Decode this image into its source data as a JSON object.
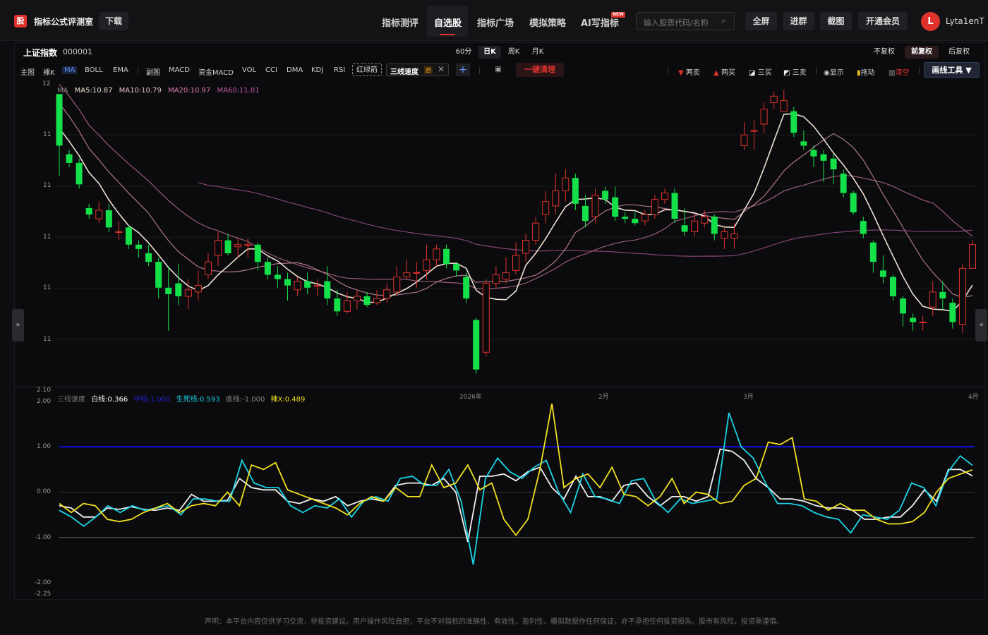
{
  "app": {
    "logo_char": "股",
    "brand": "指标公式评测室",
    "download": "下载"
  },
  "nav": [
    {
      "label": "指标测评"
    },
    {
      "label": "自选股"
    },
    {
      "label": "指标广场"
    },
    {
      "label": "模拟策略"
    },
    {
      "label": "AI写指标"
    }
  ],
  "nav_badge": "NEW",
  "search": {
    "placeholder": "输入股票代码/名称"
  },
  "actions": {
    "fullscreen": "全屏",
    "join_group": "进群",
    "screenshot": "截图",
    "membership": "开通会员"
  },
  "user": {
    "initial": "L",
    "name": "Lyta1enT"
  },
  "stock": {
    "name": "上证指数",
    "code": "000001"
  },
  "periods": [
    {
      "label": "60分"
    },
    {
      "label": "日K"
    },
    {
      "label": "周K"
    },
    {
      "label": "月K"
    }
  ],
  "adjust": [
    {
      "label": "不复权"
    },
    {
      "label": "前复权"
    },
    {
      "label": "后复权"
    }
  ],
  "indicators": [
    "主图",
    "裸K",
    "MA",
    "BOLL",
    "EMA",
    "副图",
    "MACD",
    "资金MACD",
    "VOL",
    "CCI",
    "DMA",
    "KDJ",
    "RSI"
  ],
  "custom_ind": {
    "dashed": "红绿箭",
    "active": "三线速度",
    "tag": "自"
  },
  "toolbar": {
    "add": "+",
    "clear": "一键清理",
    "two_sell": "两卖",
    "two_buy": "两买",
    "three_buy": "三买",
    "three_sell": "三卖",
    "show": "显示",
    "drag": "拖动",
    "clear_all": "清空",
    "draw_tools": "画线工具"
  },
  "ma_legend": {
    "title": "MA",
    "ma5": "MA5:10.87",
    "ma10": "MA10:10.79",
    "ma20": "MA20:10.97",
    "ma60": "MA60:11.01"
  },
  "price_axis": [
    "12",
    "11",
    "11",
    "11",
    "11",
    "11"
  ],
  "sub_legend": {
    "title": "三线速度",
    "white": "白线:0.366",
    "blue": "中线:1.000",
    "cyan": "生死线:0.593",
    "bottom": "底线:-1.000",
    "yellow": "辣X:0.489"
  },
  "sub_axis_top": "2.10",
  "sub_axis": [
    "2.00",
    "1.00",
    "0.00",
    "-1.00",
    "-2.00",
    "-2.25"
  ],
  "date_labels": [
    "2026年",
    "2月",
    "3月",
    "4月"
  ],
  "sidebtn": {
    "left": "»",
    "right": "«"
  },
  "disclaimer": "声明：本平台内容仅供学习交流，非投资建议。用户操作风险自担；平台不对指标的准确性、有效性、盈利性、模拟数据作任何保证，亦不承担任何投资损失。股市有风险，投资需谨慎。",
  "colors": {
    "up": "#e0322d",
    "down": "#14e04a",
    "ma5": "#ede0d0",
    "ma10": "#c98aa0",
    "ma20": "#b06a88",
    "ma60": "#9a4e86",
    "white": "#f0f0f0",
    "cyan": "#19d4e6",
    "yellow": "#f0e020",
    "blue": "#1010e0",
    "accent": "#e0322d"
  },
  "chart_data": [
    {
      "type": "candlestick",
      "title": "上证指数 000001 日K",
      "y_ticks": [
        "12",
        "11",
        "11",
        "11",
        "11",
        "11"
      ],
      "x_labels": [
        "2026年",
        "2月",
        "3月",
        "4月"
      ],
      "candles": [
        [
          11.3,
          11.06,
          10.92,
          11.07
        ],
        [
          11.02,
          10.98,
          10.96,
          11.04
        ],
        [
          10.98,
          10.88,
          10.86,
          11.0
        ],
        [
          10.77,
          10.74,
          10.72,
          10.79
        ],
        [
          10.72,
          10.76,
          10.7,
          10.8
        ],
        [
          10.76,
          10.68,
          10.66,
          10.79
        ],
        [
          10.66,
          10.66,
          10.62,
          10.71
        ],
        [
          10.68,
          10.6,
          10.58,
          10.69
        ],
        [
          10.6,
          10.58,
          10.54,
          10.62
        ],
        [
          10.56,
          10.52,
          10.5,
          10.6
        ],
        [
          10.52,
          10.4,
          10.35,
          10.54
        ],
        [
          10.4,
          10.37,
          10.2,
          10.5
        ],
        [
          10.42,
          10.36,
          10.32,
          10.51
        ],
        [
          10.36,
          10.39,
          10.3,
          10.44
        ],
        [
          10.38,
          10.41,
          10.34,
          10.48
        ],
        [
          10.46,
          10.52,
          10.44,
          10.56
        ],
        [
          10.55,
          10.62,
          10.5,
          10.66
        ],
        [
          10.62,
          10.56,
          10.55,
          10.65
        ],
        [
          10.59,
          10.6,
          10.54,
          10.63
        ],
        [
          10.6,
          10.6,
          10.54,
          10.63
        ],
        [
          10.6,
          10.52,
          10.48,
          10.61
        ],
        [
          10.52,
          10.46,
          10.44,
          10.54
        ],
        [
          10.46,
          10.44,
          10.4,
          10.5
        ],
        [
          10.44,
          10.41,
          10.34,
          10.47
        ],
        [
          10.39,
          10.43,
          10.36,
          10.45
        ],
        [
          10.43,
          10.4,
          10.37,
          10.47
        ],
        [
          10.41,
          10.41,
          10.36,
          10.44
        ],
        [
          10.43,
          10.35,
          10.32,
          10.5
        ],
        [
          10.35,
          10.29,
          10.27,
          10.39
        ],
        [
          10.29,
          10.34,
          10.28,
          10.38
        ],
        [
          10.34,
          10.36,
          10.3,
          10.39
        ],
        [
          10.36,
          10.32,
          10.31,
          10.38
        ],
        [
          10.33,
          10.35,
          10.32,
          10.39
        ],
        [
          10.35,
          10.39,
          10.33,
          10.42
        ],
        [
          10.38,
          10.45,
          10.37,
          10.5
        ],
        [
          10.45,
          10.47,
          10.44,
          10.53
        ],
        [
          10.47,
          10.47,
          10.4,
          10.52
        ],
        [
          10.48,
          10.53,
          10.44,
          10.6
        ],
        [
          10.53,
          10.58,
          10.5,
          10.6
        ],
        [
          10.58,
          10.51,
          10.49,
          10.6
        ],
        [
          10.51,
          10.48,
          10.45,
          10.52
        ],
        [
          10.45,
          10.35,
          10.33,
          10.47
        ],
        [
          10.25,
          10.02,
          10.0,
          10.26
        ],
        [
          10.1,
          10.42,
          10.08,
          10.44
        ],
        [
          10.42,
          10.46,
          10.4,
          10.5
        ],
        [
          10.44,
          10.47,
          10.42,
          10.54
        ],
        [
          10.48,
          10.55,
          10.46,
          10.61
        ],
        [
          10.56,
          10.62,
          10.52,
          10.65
        ],
        [
          10.62,
          10.7,
          10.6,
          10.73
        ],
        [
          10.74,
          10.8,
          10.7,
          10.85
        ],
        [
          10.78,
          10.85,
          10.74,
          10.93
        ],
        [
          10.85,
          10.91,
          10.8,
          10.95
        ],
        [
          10.91,
          10.79,
          10.76,
          10.93
        ],
        [
          10.78,
          10.71,
          10.68,
          10.83
        ],
        [
          10.73,
          10.83,
          10.7,
          10.86
        ],
        [
          10.85,
          10.81,
          10.79,
          10.87
        ],
        [
          10.82,
          10.73,
          10.71,
          10.87
        ],
        [
          10.73,
          10.72,
          10.7,
          10.75
        ],
        [
          10.72,
          10.7,
          10.69,
          10.75
        ],
        [
          10.71,
          10.74,
          10.69,
          10.76
        ],
        [
          10.74,
          10.81,
          10.72,
          10.83
        ],
        [
          10.81,
          10.84,
          10.79,
          10.86
        ],
        [
          10.84,
          10.72,
          10.7,
          10.86
        ],
        [
          10.69,
          10.66,
          10.64,
          10.77
        ],
        [
          10.66,
          10.71,
          10.64,
          10.74
        ],
        [
          10.7,
          10.73,
          10.68,
          10.76
        ],
        [
          10.73,
          10.65,
          10.62,
          10.74
        ],
        [
          10.63,
          10.66,
          10.58,
          10.68
        ],
        [
          10.63,
          10.65,
          10.58,
          10.7
        ],
        [
          11.06,
          11.11,
          11.04,
          11.17
        ],
        [
          11.13,
          11.13,
          11.04,
          11.18
        ],
        [
          11.16,
          11.23,
          11.12,
          11.26
        ],
        [
          11.26,
          11.29,
          11.23,
          11.31
        ],
        [
          11.22,
          11.27,
          11.23,
          11.32
        ],
        [
          11.22,
          11.12,
          11.1,
          11.24
        ],
        [
          11.08,
          11.06,
          11.04,
          11.13
        ],
        [
          11.04,
          11.01,
          10.96,
          11.06
        ],
        [
          11.02,
          10.99,
          10.89,
          11.04
        ],
        [
          11.0,
          10.95,
          10.88,
          11.02
        ],
        [
          10.93,
          10.84,
          10.82,
          10.95
        ],
        [
          10.84,
          10.75,
          10.74,
          10.85
        ],
        [
          10.71,
          10.65,
          10.63,
          10.73
        ],
        [
          10.61,
          10.52,
          10.47,
          10.62
        ],
        [
          10.48,
          10.45,
          10.42,
          10.55
        ],
        [
          10.45,
          10.36,
          10.34,
          10.46
        ],
        [
          10.35,
          10.28,
          10.22,
          10.36
        ],
        [
          10.26,
          10.24,
          10.2,
          10.28
        ],
        [
          10.24,
          10.24,
          10.2,
          10.27
        ],
        [
          10.31,
          10.38,
          10.27,
          10.43
        ],
        [
          10.38,
          10.35,
          10.3,
          10.43
        ],
        [
          10.33,
          10.24,
          10.21,
          10.35
        ],
        [
          10.23,
          10.49,
          10.19,
          10.51
        ],
        [
          10.49,
          10.6,
          10.5,
          10.62
        ]
      ],
      "series": [
        {
          "name": "MA5",
          "latest": 10.87
        },
        {
          "name": "MA10",
          "latest": 10.79
        },
        {
          "name": "MA20",
          "latest": 10.97
        },
        {
          "name": "MA60",
          "latest": 11.01
        }
      ]
    },
    {
      "type": "line",
      "title": "三线速度",
      "ylim": [
        -2.25,
        2.1
      ],
      "y_ticks": [
        2.0,
        1.0,
        0.0,
        -1.0,
        -2.0
      ],
      "series": [
        {
          "name": "白线",
          "latest": 0.366,
          "values": [
            -0.3,
            -0.35,
            -0.55,
            -0.55,
            -0.35,
            -0.38,
            -0.32,
            -0.38,
            -0.4,
            -0.35,
            -0.4,
            -0.05,
            -0.2,
            -0.2,
            -0.18,
            0.3,
            0.1,
            0.05,
            0.05,
            -0.2,
            -0.25,
            -0.15,
            -0.2,
            -0.1,
            -0.3,
            -0.2,
            -0.15,
            -0.2,
            0.15,
            0.2,
            0.2,
            0.15,
            0.3,
            0.0,
            -1.1,
            0.35,
            0.35,
            0.4,
            0.25,
            0.45,
            0.55,
            0.1,
            -0.15,
            0.35,
            -0.1,
            -0.1,
            -0.2,
            0.15,
            0.2,
            -0.1,
            -0.3,
            -0.1,
            -0.1,
            -0.2,
            -0.1,
            0.95,
            0.9,
            0.7,
            0.3,
            0.1,
            -0.15,
            -0.15,
            -0.2,
            -0.3,
            -0.35,
            -0.35,
            -0.4,
            -0.6,
            -0.6,
            -0.55,
            -0.55,
            -0.3,
            0.05,
            -0.2,
            0.5,
            0.5,
            0.36
          ]
        },
        {
          "name": "生死线",
          "latest": 0.593,
          "values": [
            -0.4,
            -0.55,
            -0.75,
            -0.55,
            -0.3,
            -0.45,
            -0.3,
            -0.4,
            -0.35,
            -0.3,
            -0.5,
            -0.15,
            -0.15,
            -0.2,
            -0.2,
            0.7,
            0.2,
            0.1,
            0.1,
            -0.3,
            -0.45,
            -0.3,
            -0.35,
            -0.15,
            -0.55,
            -0.2,
            -0.1,
            -0.2,
            0.3,
            0.35,
            0.15,
            0.15,
            0.5,
            -0.2,
            -1.6,
            0.3,
            0.75,
            0.45,
            0.3,
            0.55,
            0.7,
            0.0,
            -0.45,
            0.4,
            -0.1,
            -0.15,
            -0.25,
            0.25,
            0.3,
            -0.2,
            -0.45,
            -0.15,
            -0.25,
            -0.2,
            -0.15,
            1.75,
            1.0,
            0.75,
            0.2,
            -0.25,
            -0.25,
            -0.3,
            -0.45,
            -0.55,
            -0.6,
            -0.9,
            -0.5,
            -0.55,
            -0.6,
            -0.4,
            0.2,
            0.1,
            -0.3,
            0.45,
            0.8,
            0.59
          ]
        },
        {
          "name": "辣X",
          "latest": 0.489,
          "values": [
            -0.25,
            -0.45,
            -0.25,
            -0.3,
            -0.6,
            -0.65,
            -0.6,
            -0.45,
            -0.35,
            -0.25,
            -0.45,
            -0.3,
            -0.25,
            -0.3,
            0.0,
            -0.3,
            0.6,
            0.5,
            0.65,
            0.05,
            -0.05,
            -0.15,
            -0.25,
            -0.35,
            -0.5,
            -0.25,
            -0.1,
            -0.2,
            0.1,
            -0.1,
            -0.1,
            0.6,
            0.1,
            0.2,
            0.6,
            0.05,
            0.2,
            -0.6,
            -0.95,
            -0.6,
            0.5,
            1.95,
            0.1,
            0.3,
            0.4,
            0.1,
            0.55,
            -0.05,
            -0.1,
            -0.3,
            -0.1,
            0.3,
            -0.25,
            0.0,
            -0.05,
            -0.25,
            -0.2,
            0.15,
            0.3,
            1.1,
            1.05,
            1.2,
            -0.15,
            -0.2,
            -0.4,
            -0.25,
            -0.4,
            -0.4,
            -0.6,
            -0.7,
            -0.7,
            -0.65,
            -0.45,
            0.0,
            0.3,
            0.4,
            0.49
          ]
        }
      ]
    }
  ]
}
